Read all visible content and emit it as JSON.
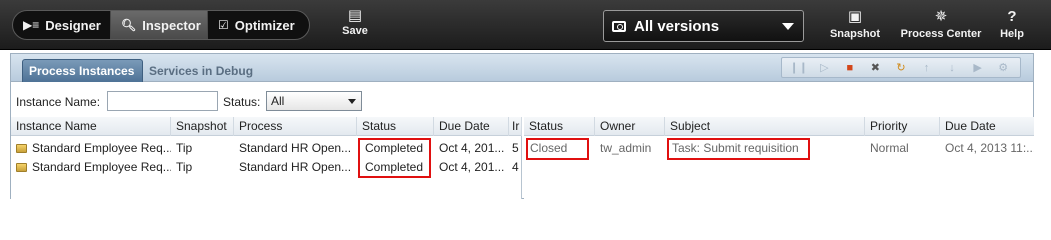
{
  "toolbar": {
    "modes": [
      {
        "label": "Designer",
        "icon": "designer-icon"
      },
      {
        "label": "Inspector",
        "icon": "search-icon"
      },
      {
        "label": "Optimizer",
        "icon": "chart-icon"
      }
    ],
    "save_label": "Save",
    "versions_label": "All versions",
    "snapshot_label": "Snapshot",
    "process_center_label": "Process Center",
    "help_label": "Help"
  },
  "panel": {
    "tabs": [
      "Process Instances",
      "Services in Debug"
    ],
    "icons": [
      "pause-icon",
      "step-icon",
      "stop-icon",
      "delete-icon",
      "refresh-icon",
      "up-icon",
      "down-icon",
      "play-icon",
      "settings-icon"
    ]
  },
  "filters": {
    "instance_name_label": "Instance Name:",
    "instance_name_value": "",
    "status_label": "Status:",
    "status_value": "All"
  },
  "instances": {
    "headers": [
      "Instance Name",
      "Snapshot",
      "Process",
      "Status",
      "Due Date",
      "Ir"
    ],
    "rows": [
      [
        "Standard Employee Req...",
        "Tip",
        "Standard HR Open...",
        "Completed",
        "Oct 4, 201...",
        "5"
      ],
      [
        "Standard Employee Req...",
        "Tip",
        "Standard HR Open...",
        "Completed",
        "Oct 4, 201...",
        "4"
      ]
    ]
  },
  "tasks": {
    "headers": [
      "Status",
      "Owner",
      "Subject",
      "Priority",
      "Due Date"
    ],
    "rows": [
      [
        "Closed",
        "tw_admin",
        "Task: Submit requisition",
        "Normal",
        "Oct 4, 2013 11:..."
      ]
    ]
  },
  "colors": {
    "highlight": "#e01010",
    "accent_tab": "#4e7296",
    "toolbar_bg": "#1c1c1c"
  }
}
